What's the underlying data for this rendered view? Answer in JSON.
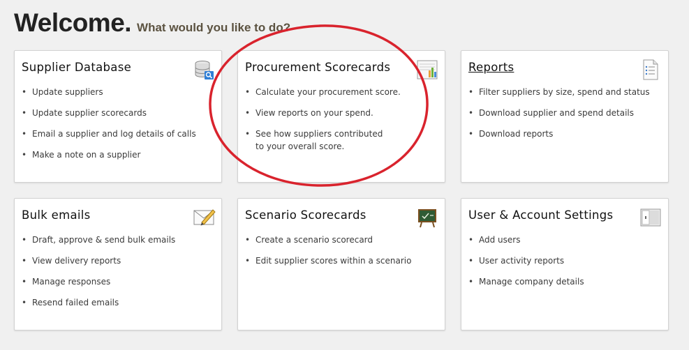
{
  "header": {
    "title": "Welcome.",
    "subtitle": "What would you like to do?"
  },
  "cards": [
    {
      "title": "Supplier Database",
      "icon": "database-search-icon",
      "items": [
        "Update suppliers",
        "Update supplier scorecards",
        "Email a supplier and log details of calls",
        "Make a note on a supplier"
      ]
    },
    {
      "title": "Procurement Scorecards",
      "icon": "bar-chart-icon",
      "items": [
        "Calculate your procurement score.",
        "View reports on your spend.",
        "See how suppliers contributed",
        "to your overall score."
      ]
    },
    {
      "title": "Reports",
      "icon": "report-document-icon",
      "items": [
        "Filter suppliers by size, spend and status",
        "Download supplier and spend details",
        "Download reports"
      ]
    },
    {
      "title": "Bulk emails",
      "icon": "envelope-pencil-icon",
      "items": [
        "Draft, approve & send bulk emails",
        "View delivery reports",
        "Manage responses",
        "Resend failed emails"
      ]
    },
    {
      "title": "Scenario Scorecards",
      "icon": "chalkboard-icon",
      "items": [
        "Create a scenario scorecard",
        "Edit supplier scores within a scenario"
      ]
    },
    {
      "title": "User & Account Settings",
      "icon": "settings-panel-icon",
      "items": [
        "Add users",
        "User activity reports",
        "Manage company details"
      ]
    }
  ],
  "colors": {
    "annotation": "#d9232d",
    "page_background": "#f0f0f0",
    "card_border": "#d2d2d2"
  }
}
